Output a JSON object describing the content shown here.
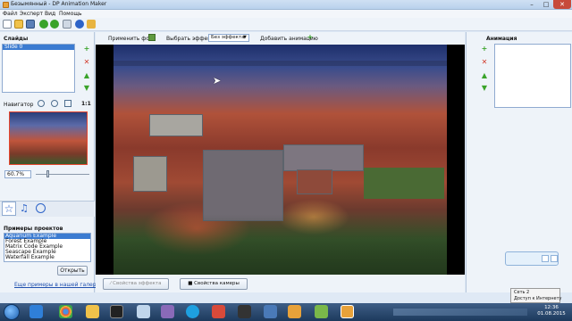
{
  "window": {
    "title": "Безымянный - DP Animation Maker"
  },
  "menu": [
    "Файл",
    "Эксперт",
    "Вид",
    "Помощь"
  ],
  "slides": {
    "header": "Слайды",
    "items": [
      "Slide 0"
    ]
  },
  "navigator": {
    "label": "Навигатор",
    "zoom": "60.7%"
  },
  "center_toolbar": {
    "apply_bg": "Применить фон",
    "choose_effect": "Выбрать эффект:",
    "effect_value": "Без эффекта",
    "add_animation": "Добавить анимацию"
  },
  "animation": {
    "header": "Анимация"
  },
  "projects": {
    "header": "Примеры проектов",
    "items": [
      "Aquarium Example",
      "Forest Example",
      "Matrix Code Example",
      "Seascape Example",
      "Waterfall Example"
    ],
    "open_button": "Открыть",
    "more_link": "Еще примеры в нашей галерее"
  },
  "bottom": {
    "effect_props": "Свойства эффекта",
    "camera_props": "Свойства камеры"
  },
  "network_popup": {
    "line1": "Сеть  2",
    "line2": "Доступ к Интернету"
  },
  "clock": {
    "time": "12:36",
    "date": "01.08.2015"
  },
  "colors": {
    "accent": "#3b7bd1",
    "green": "#3aa32a",
    "red": "#d23a2a"
  }
}
